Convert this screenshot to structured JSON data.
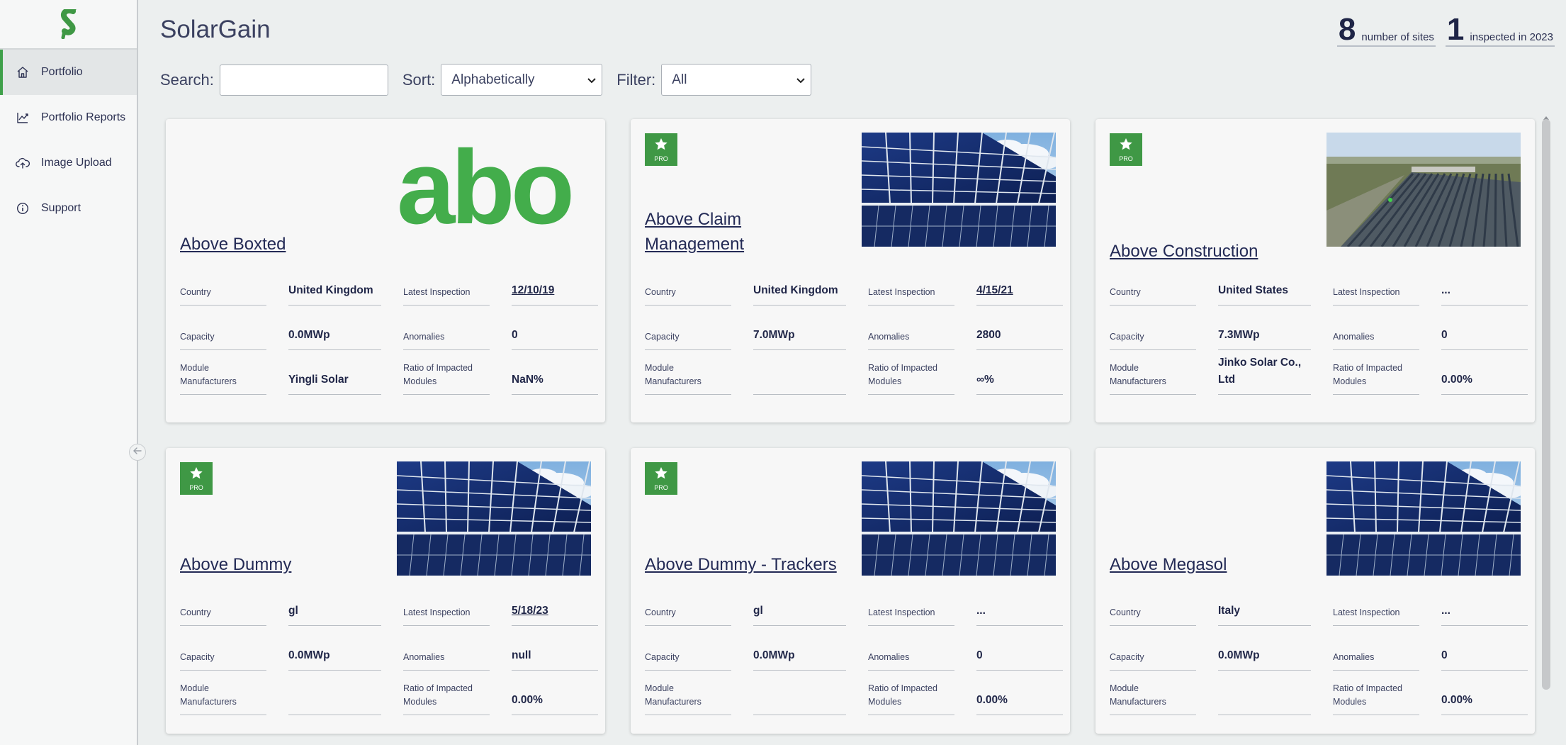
{
  "app": {
    "title": "SolarGain"
  },
  "sidebar": {
    "items": [
      {
        "label": "Portfolio",
        "icon": "home-icon",
        "active": true
      },
      {
        "label": "Portfolio Reports",
        "icon": "chart-line-icon",
        "active": false
      },
      {
        "label": "Image Upload",
        "icon": "cloud-upload-icon",
        "active": false
      },
      {
        "label": "Support",
        "icon": "info-icon",
        "active": false
      }
    ]
  },
  "stats": {
    "sites_count": "8",
    "sites_label": "number of sites",
    "inspected_count": "1",
    "inspected_label": "inspected in 2023"
  },
  "controls": {
    "search_label": "Search:",
    "search_value": "",
    "sort_label": "Sort:",
    "sort_value": "Alphabetically",
    "filter_label": "Filter:",
    "filter_value": "All"
  },
  "field_labels": {
    "country": "Country",
    "capacity": "Capacity",
    "manufacturers_1": "Module",
    "manufacturers_2": "Manufacturers",
    "latest_inspection": "Latest Inspection",
    "anomalies": "Anomalies",
    "ratio_1": "Ratio of Impacted",
    "ratio_2": "Modules"
  },
  "pro_label": "PRO",
  "sites": [
    {
      "name": "Above Boxted",
      "pro": false,
      "image": "logo",
      "logo_text": "abo",
      "country": "United Kingdom",
      "capacity": "0.0MWp",
      "manufacturers": "Yingli Solar",
      "latest_inspection": "12/10/19",
      "anomalies": "0",
      "ratio": "NaN%"
    },
    {
      "name": "Above Claim Management",
      "pro": true,
      "image": "panels",
      "country": "United Kingdom",
      "capacity": "7.0MWp",
      "manufacturers": "",
      "latest_inspection": "4/15/21",
      "anomalies": "2800",
      "ratio": "∞%"
    },
    {
      "name": "Above Construction",
      "pro": true,
      "image": "aerial",
      "country": "United States",
      "capacity": "7.3MWp",
      "manufacturers": "Jinko Solar Co., Ltd",
      "latest_inspection": "...",
      "anomalies": "0",
      "ratio": "0.00%"
    },
    {
      "name": "Above Dummy",
      "pro": true,
      "image": "panels",
      "country": "gl",
      "capacity": "0.0MWp",
      "manufacturers": "",
      "latest_inspection": "5/18/23",
      "anomalies": "null",
      "ratio": "0.00%"
    },
    {
      "name": "Above Dummy - Trackers",
      "pro": true,
      "image": "panels",
      "country": "gl",
      "capacity": "0.0MWp",
      "manufacturers": "",
      "latest_inspection": "...",
      "anomalies": "0",
      "ratio": "0.00%"
    },
    {
      "name": "Above Megasol",
      "pro": false,
      "image": "panels",
      "country": "Italy",
      "capacity": "0.0MWp",
      "manufacturers": "",
      "latest_inspection": "...",
      "anomalies": "0",
      "ratio": "0.00%"
    }
  ],
  "colors": {
    "brand_green": "#3f9845",
    "logo_green": "#43ad4b",
    "text_navy": "#1f2547",
    "page_bg": "#ecefef"
  }
}
